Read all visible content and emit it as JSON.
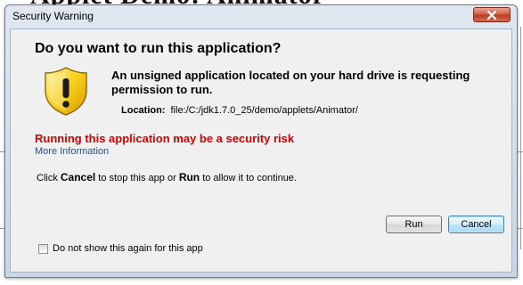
{
  "background": {
    "heading": "Applet Demo: Animator"
  },
  "window": {
    "title": "Security Warning"
  },
  "dialog": {
    "question": "Do you want to run this application?",
    "message": "An unsigned application located on your hard drive is requesting permission to run.",
    "location_label": "Location:",
    "location_value": "file:/C:/jdk1.7.0_25/demo/applets/Animator/",
    "risk_text": "Running this application may be a security risk",
    "more_info_link": "More Information",
    "instruction": {
      "prefix": "Click ",
      "cancel_word": "Cancel",
      "middle": " to stop this app or ",
      "run_word": "Run",
      "suffix": " to allow it to continue."
    }
  },
  "buttons": {
    "run": "Run",
    "cancel": "Cancel"
  },
  "checkbox": {
    "label": "Do not show this again for this app",
    "checked": false
  },
  "icons": {
    "warning": "warning-shield-icon",
    "close": "close-icon"
  },
  "colors": {
    "risk": "#d20000",
    "link": "#2a4e8a",
    "shield": "#f2c200"
  }
}
